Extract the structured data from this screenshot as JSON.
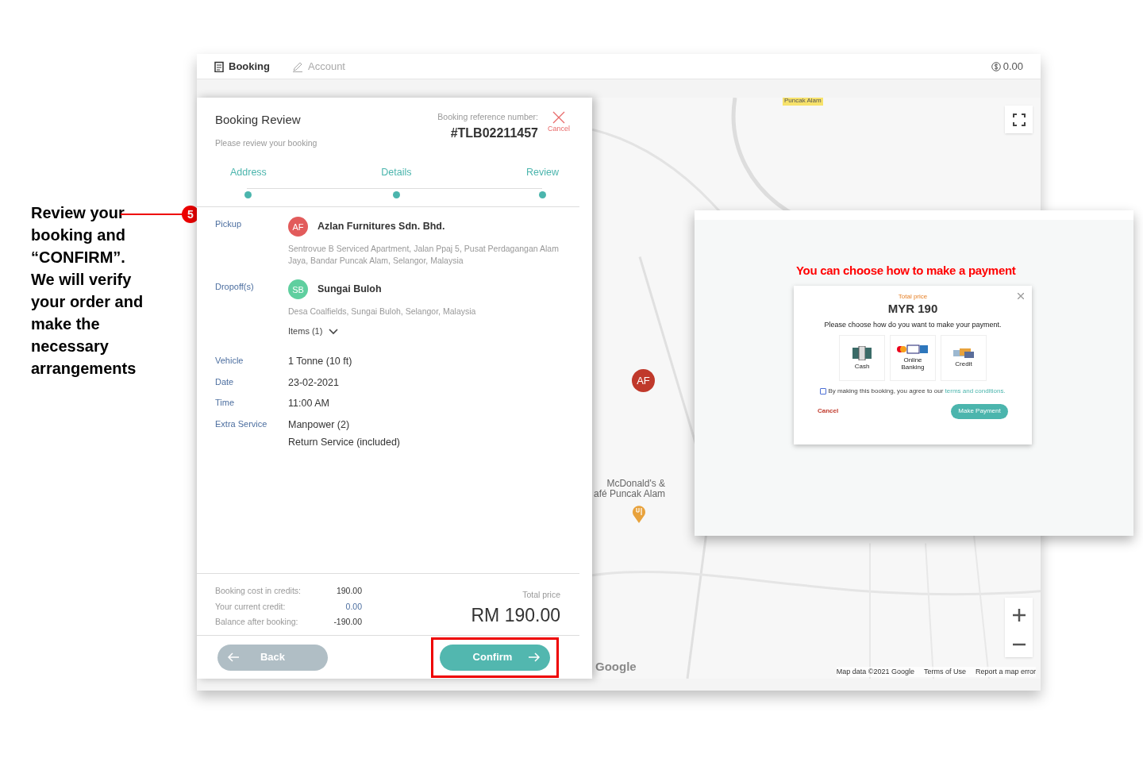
{
  "annotation": {
    "step": "5",
    "text": "Review your booking and “**CONFIRM**”. We will verify your order and make the necessary arrangements"
  },
  "nav": {
    "tabs": [
      {
        "label": "Booking",
        "selected": true
      },
      {
        "label": "Account",
        "selected": false
      }
    ],
    "balance": "0.00"
  },
  "review": {
    "title": "Booking Review",
    "subtitle": "Please review your booking",
    "reference_label": "Booking reference number:",
    "reference": "#TLB02211457",
    "cancel": "Cancel",
    "steps": [
      {
        "label": "Address",
        "done": true
      },
      {
        "label": "Details",
        "done": true
      },
      {
        "label": "Review",
        "done": true
      }
    ],
    "pickup": {
      "label": "Pickup",
      "initials": "AF",
      "name": "Azlan Furnitures Sdn. Bhd.",
      "address": "Sentrovue B Serviced Apartment, Jalan Ppaj 5, Pusat Perdagangan Alam Jaya, Bandar Puncak Alam, Selangor, Malaysia"
    },
    "dropoff": {
      "label": "Dropoff(s)",
      "initials": "SB",
      "name": "Sungai Buloh",
      "address": "Desa Coalfields, Sungai Buloh, Selangor, Malaysia",
      "items": "Items (1)"
    },
    "details": [
      {
        "label": "Vehicle",
        "value": [
          "1 Tonne (10 ft)"
        ]
      },
      {
        "label": "Date",
        "value": [
          "23-02-2021"
        ]
      },
      {
        "label": "Time",
        "value": [
          "11:00 AM"
        ]
      },
      {
        "label": "Extra Service",
        "value": [
          "Manpower (2)",
          "Return Service (included)"
        ]
      }
    ],
    "credits": [
      {
        "label": "Booking cost in credits:",
        "value": "190.00"
      },
      {
        "label": "Your current credit:",
        "value": "0.00"
      },
      {
        "label": "Balance after booking:",
        "value": "-190.00"
      }
    ],
    "total_label": "Total price",
    "total": "RM 190.00",
    "back": "Back",
    "confirm": "Confirm"
  },
  "map": {
    "area_label": "Puncak Alam",
    "marker": "AF",
    "place": [
      "McDonald's &",
      "afé Puncak Alam"
    ],
    "logo": "Google",
    "footer": [
      "Map data ©2021 Google",
      "Terms of Use",
      "Report a map error"
    ]
  },
  "inset": {
    "caption": "You can choose how to make a payment",
    "modal": {
      "total_label": "Total price",
      "total": "MYR 190",
      "prompt": "Please choose how do you want to make your payment.",
      "options": [
        {
          "label": "Cash",
          "kind": "cash"
        },
        {
          "label": "Online Banking",
          "kind": "online"
        },
        {
          "label": "Credit",
          "kind": "credit"
        }
      ],
      "agree": {
        "checked": false,
        "text": "By making this booking, you agree to our ",
        "link": "terms and conditions."
      },
      "cancel": "Cancel",
      "pay": "Make Payment"
    }
  }
}
